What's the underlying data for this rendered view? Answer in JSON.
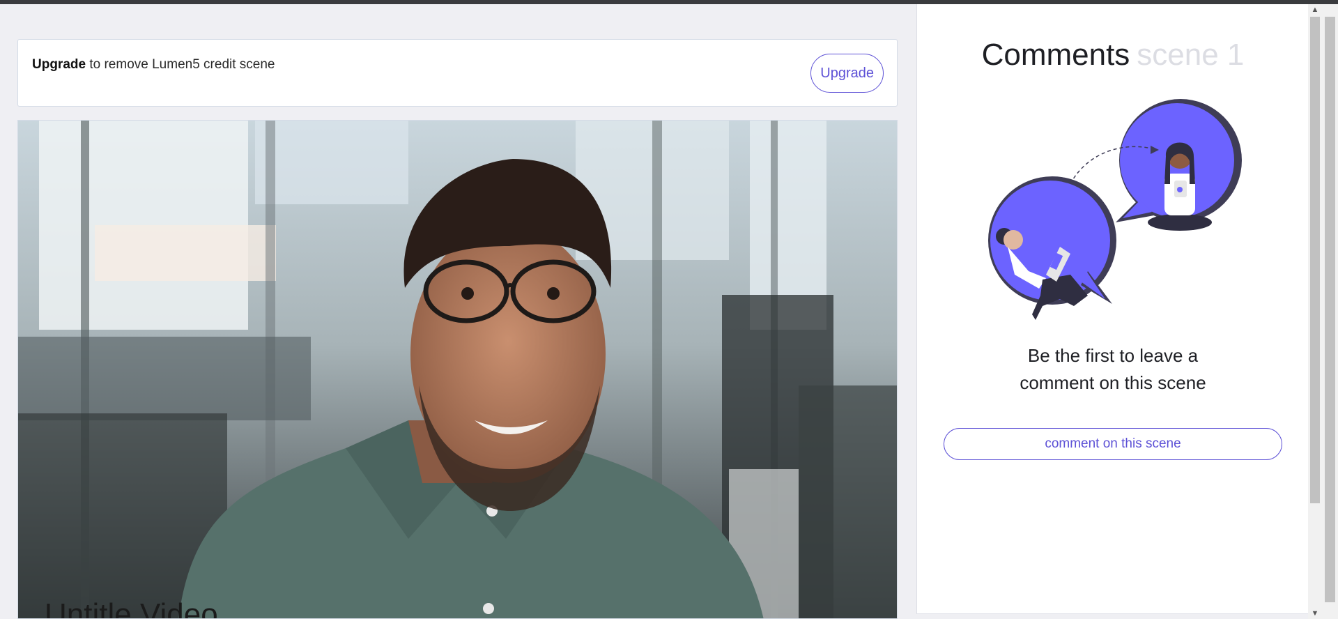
{
  "banner": {
    "strong": "Upgrade",
    "text": " to remove Lumen5 credit scene",
    "button_label": "Upgrade"
  },
  "video": {
    "caption": "Untitle Video"
  },
  "comments": {
    "title": "Comments",
    "scene_label": "scene 1",
    "empty_line1": "Be the first to leave a",
    "empty_line2": "comment on this scene",
    "button_label": "comment on this scene"
  },
  "scrollbar": {
    "up_glyph": "▲",
    "down_glyph": "▼"
  },
  "colors": {
    "accent": "#5d51d6",
    "bubble": "#6c63ff"
  }
}
